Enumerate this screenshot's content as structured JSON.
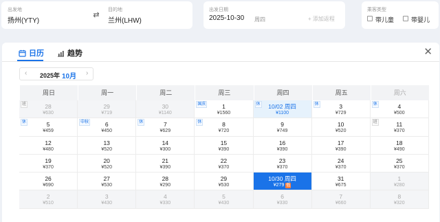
{
  "search": {
    "from_label": "出发地",
    "from_value": "扬州(YTY)",
    "to_label": "目的地",
    "to_value": "兰州(LHW)",
    "date_label": "出发日期",
    "date_value": "2025-10-30",
    "date_weekday": "周四",
    "add_return": "+ 添加返程",
    "passenger_label": "乘客类型",
    "child": "带儿童",
    "infant": "带婴儿"
  },
  "tabs": {
    "calendar": "日历",
    "trend": "趋势"
  },
  "month": {
    "year": "2025年",
    "month": "10月"
  },
  "weekdays": [
    "周日",
    "周一",
    "周二",
    "周三",
    "周四",
    "周五",
    "周六"
  ],
  "weeks": [
    [
      {
        "d": "28",
        "p": "¥630",
        "muted": true,
        "tag": "班"
      },
      {
        "d": "29",
        "p": "¥719",
        "muted": true
      },
      {
        "d": "30",
        "p": "¥1140",
        "muted": true
      },
      {
        "d": "1",
        "p": "¥1560",
        "tag": "国庆"
      },
      {
        "d": "10/02 周四",
        "p": "¥1100",
        "tag": "休",
        "return": true
      },
      {
        "d": "3",
        "p": "¥729",
        "tag": "休"
      },
      {
        "d": "4",
        "p": "¥500",
        "tag": "休"
      }
    ],
    [
      {
        "d": "5",
        "p": "¥459",
        "tag": "休"
      },
      {
        "d": "6",
        "p": "¥450",
        "tag": "中秋"
      },
      {
        "d": "7",
        "p": "¥629",
        "tag": "休"
      },
      {
        "d": "8",
        "p": "¥720",
        "tag": "休"
      },
      {
        "d": "9",
        "p": "¥749"
      },
      {
        "d": "10",
        "p": "¥520"
      },
      {
        "d": "11",
        "p": "¥370",
        "tag": "班"
      }
    ],
    [
      {
        "d": "12",
        "p": "¥480"
      },
      {
        "d": "13",
        "p": "¥520"
      },
      {
        "d": "14",
        "p": "¥300"
      },
      {
        "d": "15",
        "p": "¥390"
      },
      {
        "d": "16",
        "p": "¥390"
      },
      {
        "d": "17",
        "p": "¥390"
      },
      {
        "d": "18",
        "p": "¥490"
      }
    ],
    [
      {
        "d": "19",
        "p": "¥370"
      },
      {
        "d": "20",
        "p": "¥520"
      },
      {
        "d": "21",
        "p": "¥390"
      },
      {
        "d": "22",
        "p": "¥370"
      },
      {
        "d": "23",
        "p": "¥370"
      },
      {
        "d": "24",
        "p": "¥370"
      },
      {
        "d": "25",
        "p": "¥370"
      }
    ],
    [
      {
        "d": "26",
        "p": "¥690"
      },
      {
        "d": "27",
        "p": "¥530"
      },
      {
        "d": "28",
        "p": "¥290"
      },
      {
        "d": "29",
        "p": "¥530"
      },
      {
        "d": "10/30 周四",
        "p": "¥279",
        "selected": true,
        "low": "低"
      },
      {
        "d": "31",
        "p": "¥675"
      },
      {
        "d": "1",
        "p": "¥280",
        "muted": true
      }
    ],
    [
      {
        "d": "2",
        "p": "¥510",
        "muted": true
      },
      {
        "d": "3",
        "p": "¥430",
        "muted": true
      },
      {
        "d": "4",
        "p": "¥330",
        "muted": true
      },
      {
        "d": "5",
        "p": "¥430",
        "muted": true
      },
      {
        "d": "6",
        "p": "¥330",
        "muted": true
      },
      {
        "d": "7",
        "p": "¥660",
        "muted": true
      },
      {
        "d": "8",
        "p": "¥320",
        "muted": true
      }
    ]
  ]
}
